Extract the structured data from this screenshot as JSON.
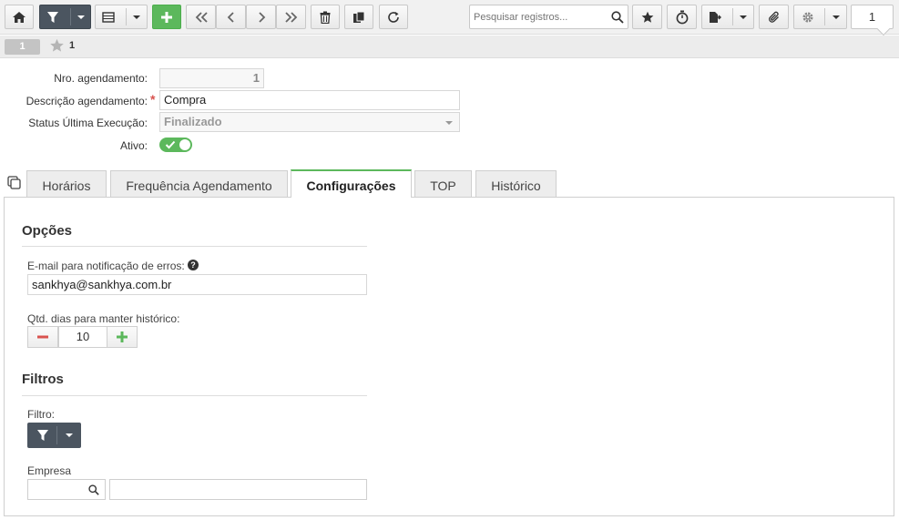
{
  "toolbar": {
    "search_placeholder": "Pesquisar registros...",
    "page_number": "1"
  },
  "record": {
    "badge": "1",
    "favorite_count": "1"
  },
  "form": {
    "nro_label": "Nro. agendamento:",
    "nro_value": "1",
    "descricao_label": "Descrição agendamento:",
    "descricao_value": "Compra",
    "required_mark": "*",
    "status_label": "Status Última Execução:",
    "status_value": "Finalizado",
    "ativo_label": "Ativo:",
    "ativo_on": true
  },
  "tabs": [
    {
      "label": "Horários"
    },
    {
      "label": "Frequência Agendamento"
    },
    {
      "label": "Configurações"
    },
    {
      "label": "TOP"
    },
    {
      "label": "Histórico"
    }
  ],
  "active_tab": "Configurações",
  "opcoes": {
    "title": "Opções",
    "email_label": "E-mail para notificação de erros:",
    "help_glyph": "?",
    "email_value": "sankhya@sankhya.com.br",
    "dias_label": "Qtd. dias para manter histórico:",
    "dias_value": "10"
  },
  "filtros": {
    "title": "Filtros",
    "filtro_label": "Filtro:",
    "empresa_label": "Empresa",
    "empresa_code": "",
    "empresa_name": ""
  },
  "colors": {
    "accent_green": "#5cb85c",
    "dark_button": "#4b5560",
    "required_red": "#d9534f"
  }
}
